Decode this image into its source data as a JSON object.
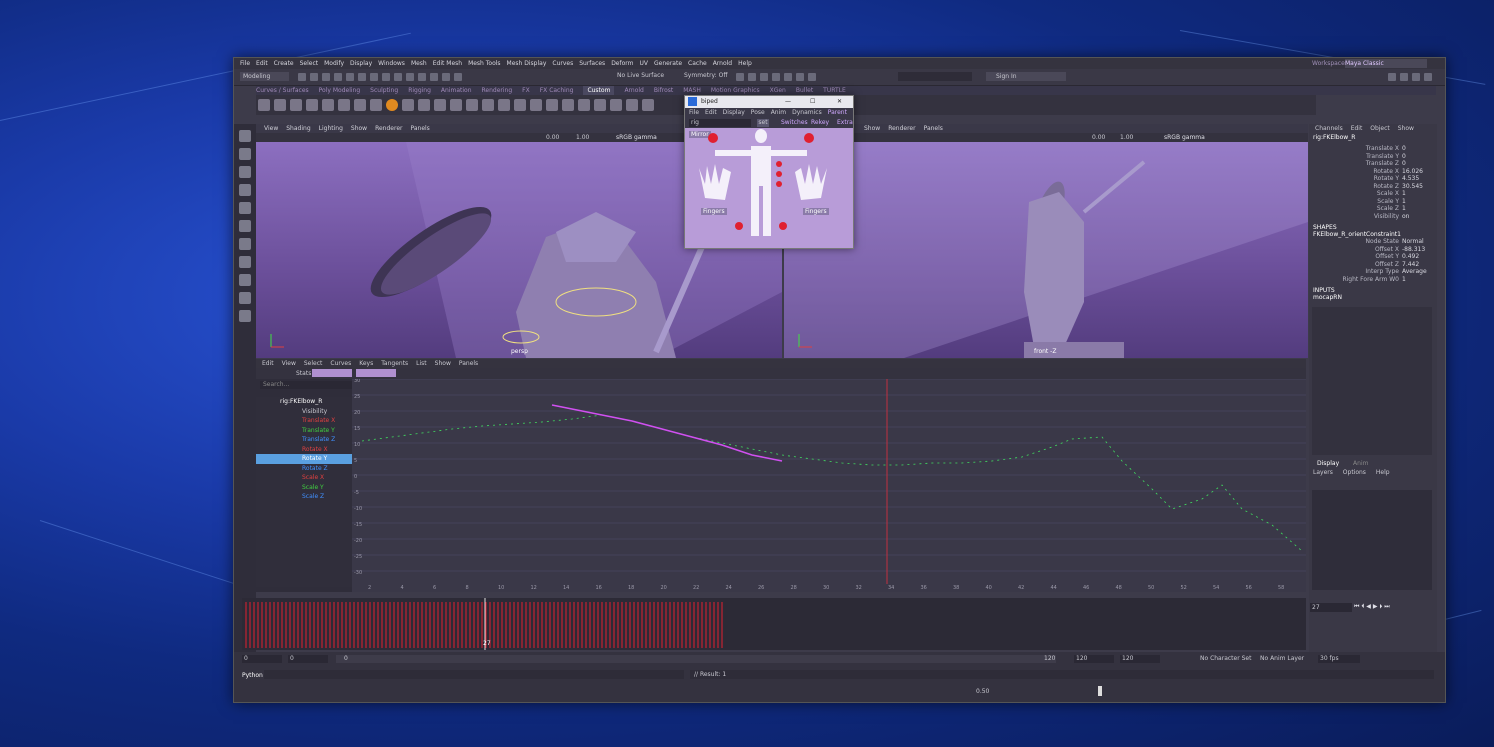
{
  "app": {
    "name": "Maya",
    "logo_letter": "M"
  },
  "menu": [
    "File",
    "Edit",
    "Create",
    "Select",
    "Modify",
    "Display",
    "Windows",
    "Mesh",
    "Edit Mesh",
    "Mesh Tools",
    "Mesh Display",
    "Curves",
    "Surfaces",
    "Deform",
    "UV",
    "Generate",
    "Cache",
    "Arnold",
    "Help"
  ],
  "workspace": {
    "label": "Workspace :",
    "value": "Maya Classic"
  },
  "toolbar": {
    "mode": "Modeling",
    "live_surface": "No Live Surface",
    "symmetry": "Symmetry: Off",
    "sign_in": "Sign In"
  },
  "shelf_tabs": [
    "Curves / Surfaces",
    "Poly Modeling",
    "Sculpting",
    "Rigging",
    "Animation",
    "Rendering",
    "FX",
    "FX Caching",
    "Custom",
    "Arnold",
    "Bifrost",
    "MASH",
    "Motion Graphics",
    "XGen",
    "Bullet",
    "TURTLE"
  ],
  "shelf_active": "Custom",
  "viewport_menu": [
    "View",
    "Shading",
    "Lighting",
    "Show",
    "Renderer",
    "Panels"
  ],
  "viewport_right_menu": [
    "Show",
    "Renderer",
    "Panels"
  ],
  "viewport": {
    "left_label": "persp",
    "right_label": "front -Z",
    "exposure": "0.00",
    "gamma": "1.00",
    "color_space": "sRGB gamma"
  },
  "picker": {
    "title": "biped",
    "menu": [
      "File",
      "Edit",
      "Display",
      "Pose",
      "Anim",
      "Dynamics",
      "Parent"
    ],
    "rig_field": "rig",
    "set_button": "set",
    "tabs": [
      "Switches",
      "Rekey",
      "Extra"
    ],
    "mirror_label": "Mirror",
    "fingers_label": "Fingers"
  },
  "channel_box": {
    "tabs": [
      "Channels",
      "Edit",
      "Object",
      "Show"
    ],
    "object": "rig:FKElbow_R",
    "channels": [
      {
        "name": "Translate X",
        "value": "0"
      },
      {
        "name": "Translate Y",
        "value": "0"
      },
      {
        "name": "Translate Z",
        "value": "0"
      },
      {
        "name": "Rotate X",
        "value": "16.026"
      },
      {
        "name": "Rotate Y",
        "value": "4.535"
      },
      {
        "name": "Rotate Z",
        "value": "30.545"
      },
      {
        "name": "Scale X",
        "value": "1"
      },
      {
        "name": "Scale Y",
        "value": "1"
      },
      {
        "name": "Scale Z",
        "value": "1"
      },
      {
        "name": "Visibility",
        "value": "on"
      }
    ],
    "shapes_header": "SHAPES",
    "shape_name": "FKElbow_R_orientConstraint1",
    "shape_channels": [
      {
        "name": "Node State",
        "value": "Normal"
      },
      {
        "name": "Offset X",
        "value": "-88.313"
      },
      {
        "name": "Offset Y",
        "value": "0.492"
      },
      {
        "name": "Offset Z",
        "value": "7.442"
      },
      {
        "name": "Interp Type",
        "value": "Average"
      },
      {
        "name": "Right Fore Arm W0",
        "value": "1"
      }
    ],
    "inputs_header": "INPUTS",
    "input_name": "mocapRN",
    "layer_tabs": [
      "Display",
      "Anim"
    ],
    "layer_menu": [
      "Layers",
      "Options",
      "Help"
    ]
  },
  "graph_editor": {
    "menu": [
      "Edit",
      "View",
      "Select",
      "Curves",
      "Keys",
      "Tangents",
      "List",
      "Show",
      "Panels"
    ],
    "stats_label": "Stats",
    "search_placeholder": "Search...",
    "outliner_root": "rig:FKElbow_R",
    "outliner_items": [
      {
        "name": "Visibility",
        "color": "#c8c8d0"
      },
      {
        "name": "Translate X",
        "color": "#e04040"
      },
      {
        "name": "Translate Y",
        "color": "#40d040"
      },
      {
        "name": "Translate Z",
        "color": "#4090ff"
      },
      {
        "name": "Rotate X",
        "color": "#e04040"
      },
      {
        "name": "Rotate Y",
        "color": "#ffffff"
      },
      {
        "name": "Rotate Z",
        "color": "#4090ff"
      },
      {
        "name": "Scale X",
        "color": "#e04040"
      },
      {
        "name": "Scale Y",
        "color": "#40d040"
      },
      {
        "name": "Scale Z",
        "color": "#4090ff"
      }
    ],
    "selected_item": "Rotate Y",
    "y_ticks": [
      "30",
      "25",
      "20",
      "15",
      "10",
      "5",
      "0",
      "-5",
      "-10",
      "-15",
      "-20",
      "-25",
      "-30"
    ],
    "x_ticks": [
      "2",
      "4",
      "6",
      "8",
      "10",
      "12",
      "14",
      "16",
      "18",
      "20",
      "22",
      "24",
      "26",
      "28",
      "30",
      "32",
      "34",
      "36",
      "38",
      "40",
      "42",
      "44",
      "46",
      "48",
      "50",
      "52",
      "54",
      "56",
      "58"
    ]
  },
  "timeline": {
    "current_frame": "27",
    "current_frame_field": "27"
  },
  "range": {
    "start": "0",
    "inner_start": "0",
    "inner_end": "120",
    "end": "120",
    "end_field": "120",
    "end2": "120"
  },
  "bottom": {
    "character_set": "No Character Set",
    "anim_layer": "No Anim Layer",
    "fps": "30 fps",
    "command_label": "Python",
    "result": "// Result: 1",
    "time_value": "0.50"
  },
  "colors": {
    "accent": "#8a5ad0",
    "keyframe": "#e02030",
    "selection": "#5aa0e0"
  }
}
